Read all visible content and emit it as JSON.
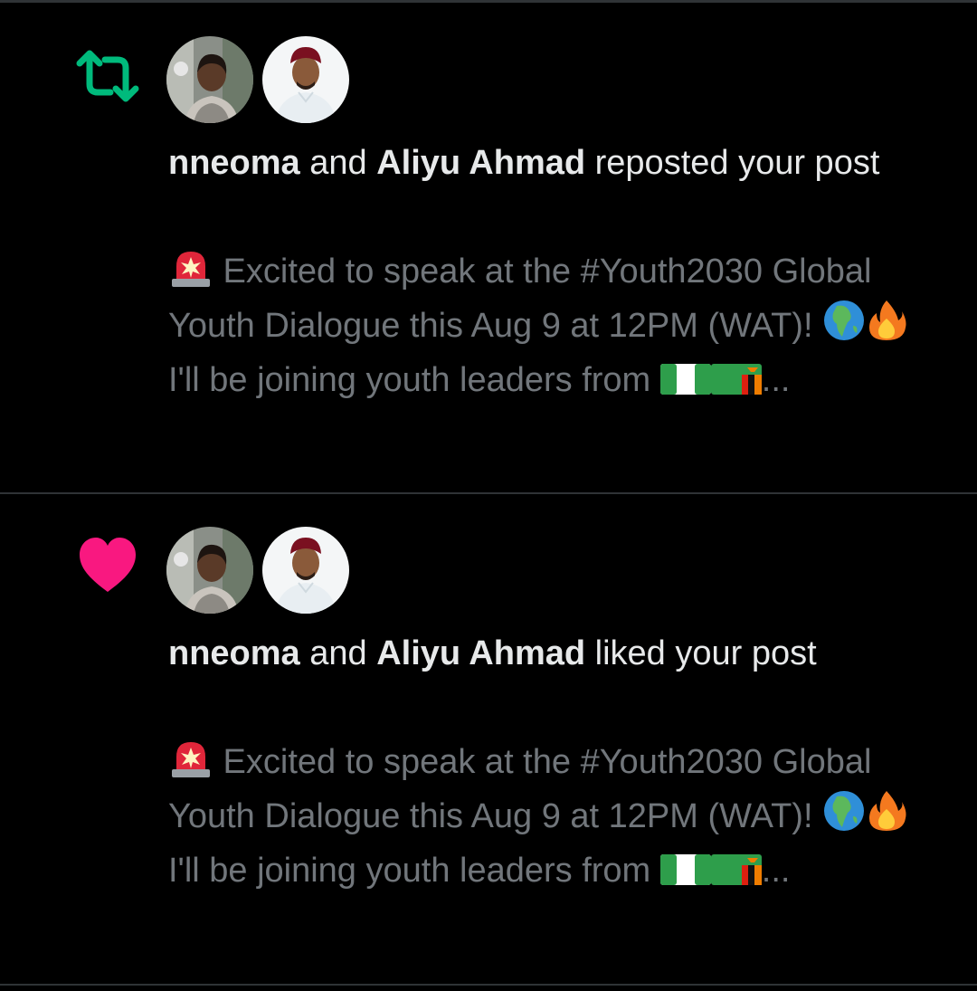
{
  "notifications": [
    {
      "type": "repost",
      "icon": "repost-icon",
      "icon_color": "#00ba7c",
      "users": [
        "nneoma",
        "Aliyu Ahmad"
      ],
      "joiner": " and ",
      "action_text": " reposted your post",
      "preview_line1": " Excited to speak at the #Youth2030 Global Youth Dialogue this Aug 9 at 12PM (WAT)! ",
      "preview_line2": "I'll be joining youth leaders from ",
      "ellipsis": "..."
    },
    {
      "type": "like",
      "icon": "heart-icon",
      "icon_color": "#f91880",
      "users": [
        "nneoma",
        "Aliyu Ahmad"
      ],
      "joiner": " and ",
      "action_text": " liked your post",
      "preview_line1": " Excited to speak at the #Youth2030 Global Youth Dialogue this Aug 9 at 12PM (WAT)! ",
      "preview_line2": "I'll be joining youth leaders from ",
      "ellipsis": "..."
    }
  ],
  "emoji_icons": [
    "rotating-light-icon",
    "globe-africa-icon",
    "fire-icon",
    "flag-nigeria-icon",
    "flag-zambia-icon"
  ]
}
